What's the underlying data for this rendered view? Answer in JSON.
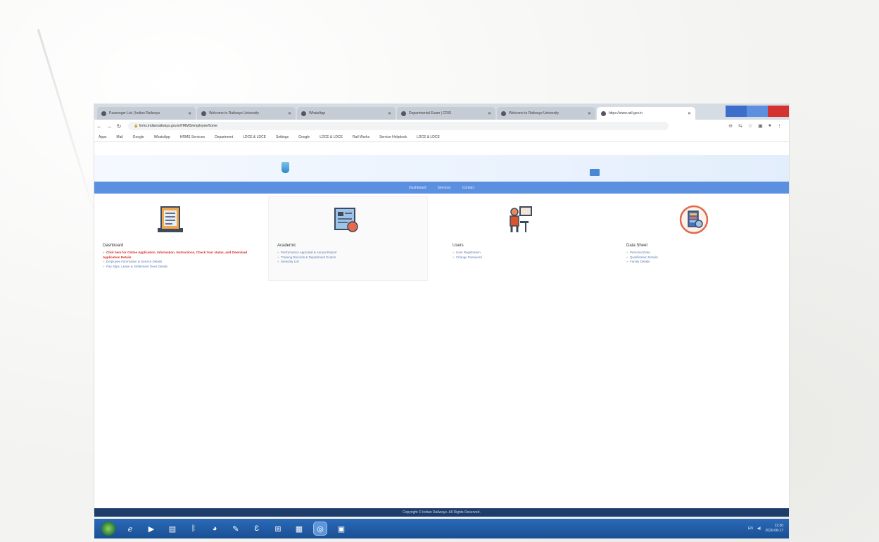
{
  "browser": {
    "tabs": [
      {
        "label": "Passenger List | Indian Railways"
      },
      {
        "label": "Welcome to Railways University"
      },
      {
        "label": "WhatsApp"
      },
      {
        "label": "Departmental Exam | CRIS"
      },
      {
        "label": "Welcome to Railways University"
      },
      {
        "label": "https://www.rail.gov.in"
      }
    ],
    "address": "hrms.indianrailways.gov.in/HRMS/employee/home",
    "bookmarks": [
      "Apps",
      "Mail",
      "Google",
      "WhatsApp",
      "HRMS Services",
      "Department",
      "LDCE & LDCE",
      "Settings",
      "Google",
      "LDCE & LDCE",
      "Rail Works",
      "Service Helpdesk",
      "LDCE & LDCE"
    ]
  },
  "nav": {
    "items": [
      "Dashboard",
      "Services",
      "Contact"
    ]
  },
  "cards": [
    {
      "title": "Dashboard",
      "links": [
        {
          "text": "Click here for Online Application. Information, Instructions, Check Your status, and Download Application Details",
          "hot": true
        },
        {
          "text": "Employee Information & Service Details"
        },
        {
          "text": "Pay Slips, Leave & Settlement Dues Details"
        }
      ]
    },
    {
      "title": "Academic",
      "links": [
        {
          "text": "Performance Appraisal & Annual Report"
        },
        {
          "text": "Training Records & Department Exams"
        },
        {
          "text": "Seniority List"
        }
      ]
    },
    {
      "title": "Users",
      "links": [
        {
          "text": "User Registration"
        },
        {
          "text": "Change Password"
        }
      ]
    },
    {
      "title": "Data Sheet",
      "links": [
        {
          "text": "Personal Data"
        },
        {
          "text": "Qualification Details"
        },
        {
          "text": "Family Details"
        }
      ]
    }
  ],
  "footer": {
    "text": "Copyright © Indian Railways. All Rights Reserved."
  },
  "taskbar": {
    "items": [
      "start",
      "internet-explorer",
      "media-player",
      "file-explorer",
      "bluetooth",
      "firefox",
      "paint",
      "word",
      "network",
      "text-editor",
      "chrome",
      "screen-app"
    ],
    "active": "chrome",
    "tray_lang": "EN",
    "tray_time": "12:30",
    "tray_date": "2020-08-17"
  },
  "colors": {
    "navbar": "#5b8fe0",
    "hot_link": "#d32525",
    "taskbar": "#1a4f93",
    "close": "#d3322f"
  }
}
